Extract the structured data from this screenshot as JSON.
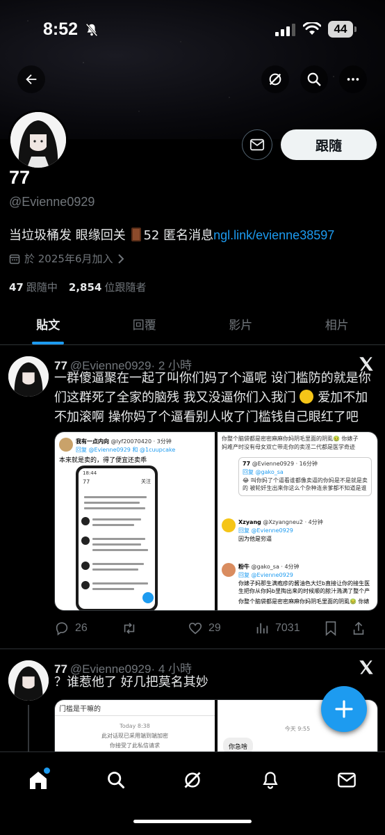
{
  "status_bar": {
    "time": "8:52",
    "battery": "44"
  },
  "profile": {
    "name": "77",
    "handle": "@Evienne0929",
    "bio_text": "当垃圾桶发 眼缘回关",
    "bio_suffix": "52 匿名消息",
    "bio_link": "ngl.link/evienne38597",
    "joined": "於 2025年6月加入",
    "following_count": "47",
    "following_label": "跟隨中",
    "followers_count": "2,854",
    "followers_label": "位跟隨者",
    "follow_button": "跟隨"
  },
  "tabs": [
    {
      "label": "貼文",
      "active": true
    },
    {
      "label": "回覆",
      "active": false
    },
    {
      "label": "影片",
      "active": false
    },
    {
      "label": "相片",
      "active": false
    }
  ],
  "tweets": [
    {
      "name": "77",
      "handle": "@Evienne0929",
      "time": "· 2 小時",
      "text_line1": "一群傻逼聚在一起了叫你们妈了个逼呢 设门槛防的就是你",
      "text_line2": "们这群死了全家的脑残 我又没逼你们入我门",
      "text_line3a": "爱加不加",
      "text_line4": "不加滚啊 操你妈了个逼看别人收了门槛钱自己眼红了吧",
      "replies": "26",
      "likes": "29",
      "views": "7031",
      "media_left": {
        "header_name": "我有一点内向",
        "header_handle": "@lyf20070420 · 3分钟",
        "reply_to": "回复 @Evienne0929 和 @1cuupcake",
        "body": "本来就是卖的，得了便宜还卖乖",
        "phone_time": "18:44",
        "phone_title": "77",
        "phone_follow": "关注"
      },
      "media_right": {
        "line1": "你整个脑袋都是密密麻麻你妈阴毛里面的阴虱🤢 你婊子",
        "line2": "妈难产时没有母女双亡带走你的卖淫二代都是医学奇迹",
        "quote_name": "77",
        "quote_handle": "@Evienne0929 · 16分钟",
        "quote_reply": "回复 @gako_sa",
        "quote_body": "😂 叫你妈了个逼看谁都像卖逼的你妈是不是就是卖的 被轮奸生出来你这么个杂种连亲爹都不知道是谁吧",
        "r2_name": "Xzyang",
        "r2_handle": "@Xzyangneu2 · 4分钟",
        "r2_reply": "回复 @Evienne0929",
        "r2_body": "因为他是穷逼",
        "r3_name": "粉牛",
        "r3_handle": "@gako_sa · 4分钟",
        "r3_reply": "回复 @Evienne0929",
        "r3_body": "你婊子妈那生满疱疹的酱油色大烂b直接让你的接生医生把你从你妈b里掏出来的时候顺的脓汁溅满了整个产房😂",
        "r3_body2": "你整个脑袋都是密密麻麻你妈阴毛里面的阴虱🤢 你婊子"
      }
    },
    {
      "name": "77",
      "handle": "@Evienne0929",
      "time": "· 4 小時",
      "text_line1": "？谁惹他了 好几把莫名其妙",
      "media_left": {
        "title": "门槛是干嘛的",
        "today": "Today 8:38",
        "notice1": "此对话现已采用端到端加密",
        "notice2": "你接受了此私信请求"
      },
      "media_right": {
        "today": "今天 9:55",
        "bubble": "你急啥"
      }
    }
  ],
  "icons": {
    "back": "arrow-left-icon",
    "grok": "grok-icon",
    "search": "search-icon",
    "more": "more-icon",
    "message": "envelope-icon",
    "calendar": "calendar-icon",
    "chevron": "chevron-right-icon",
    "x_logo": "x-logo-icon"
  },
  "colors": {
    "accent": "#1d9bf0",
    "background": "#000000",
    "secondary_text": "#71767b"
  }
}
